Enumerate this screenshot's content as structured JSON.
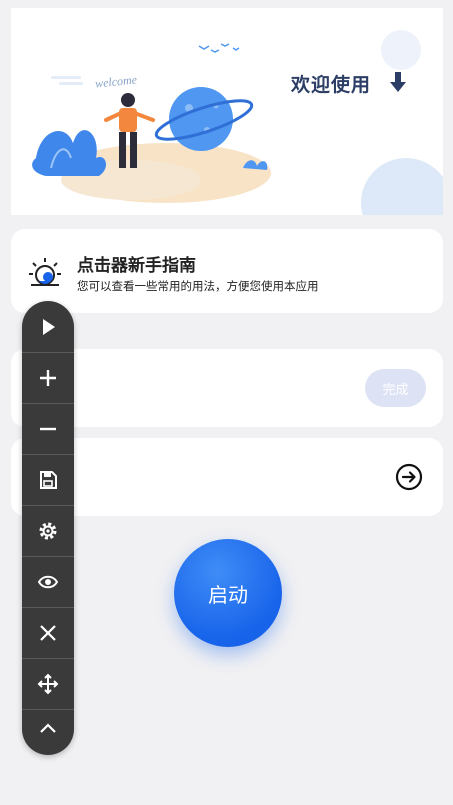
{
  "banner": {
    "welcome_title": "欢迎使用",
    "illustration_text": "welcome"
  },
  "guide": {
    "title": "点击器新手指南",
    "subtitle": "您可以查看一些常用的用法，方便您使用本应用"
  },
  "card3": {
    "done_label": "完成"
  },
  "start": {
    "label": "启动"
  },
  "toolbar": {
    "items": [
      "play-icon",
      "plus-icon",
      "minus-icon",
      "save-icon",
      "settings-icon",
      "eye-icon",
      "close-icon",
      "move-icon",
      "chevron-up-icon"
    ]
  },
  "colors": {
    "accent": "#1763ea",
    "background": "#f1f1f3",
    "toolbar": "#3a3a3a",
    "done_button": "#dde3f4"
  }
}
